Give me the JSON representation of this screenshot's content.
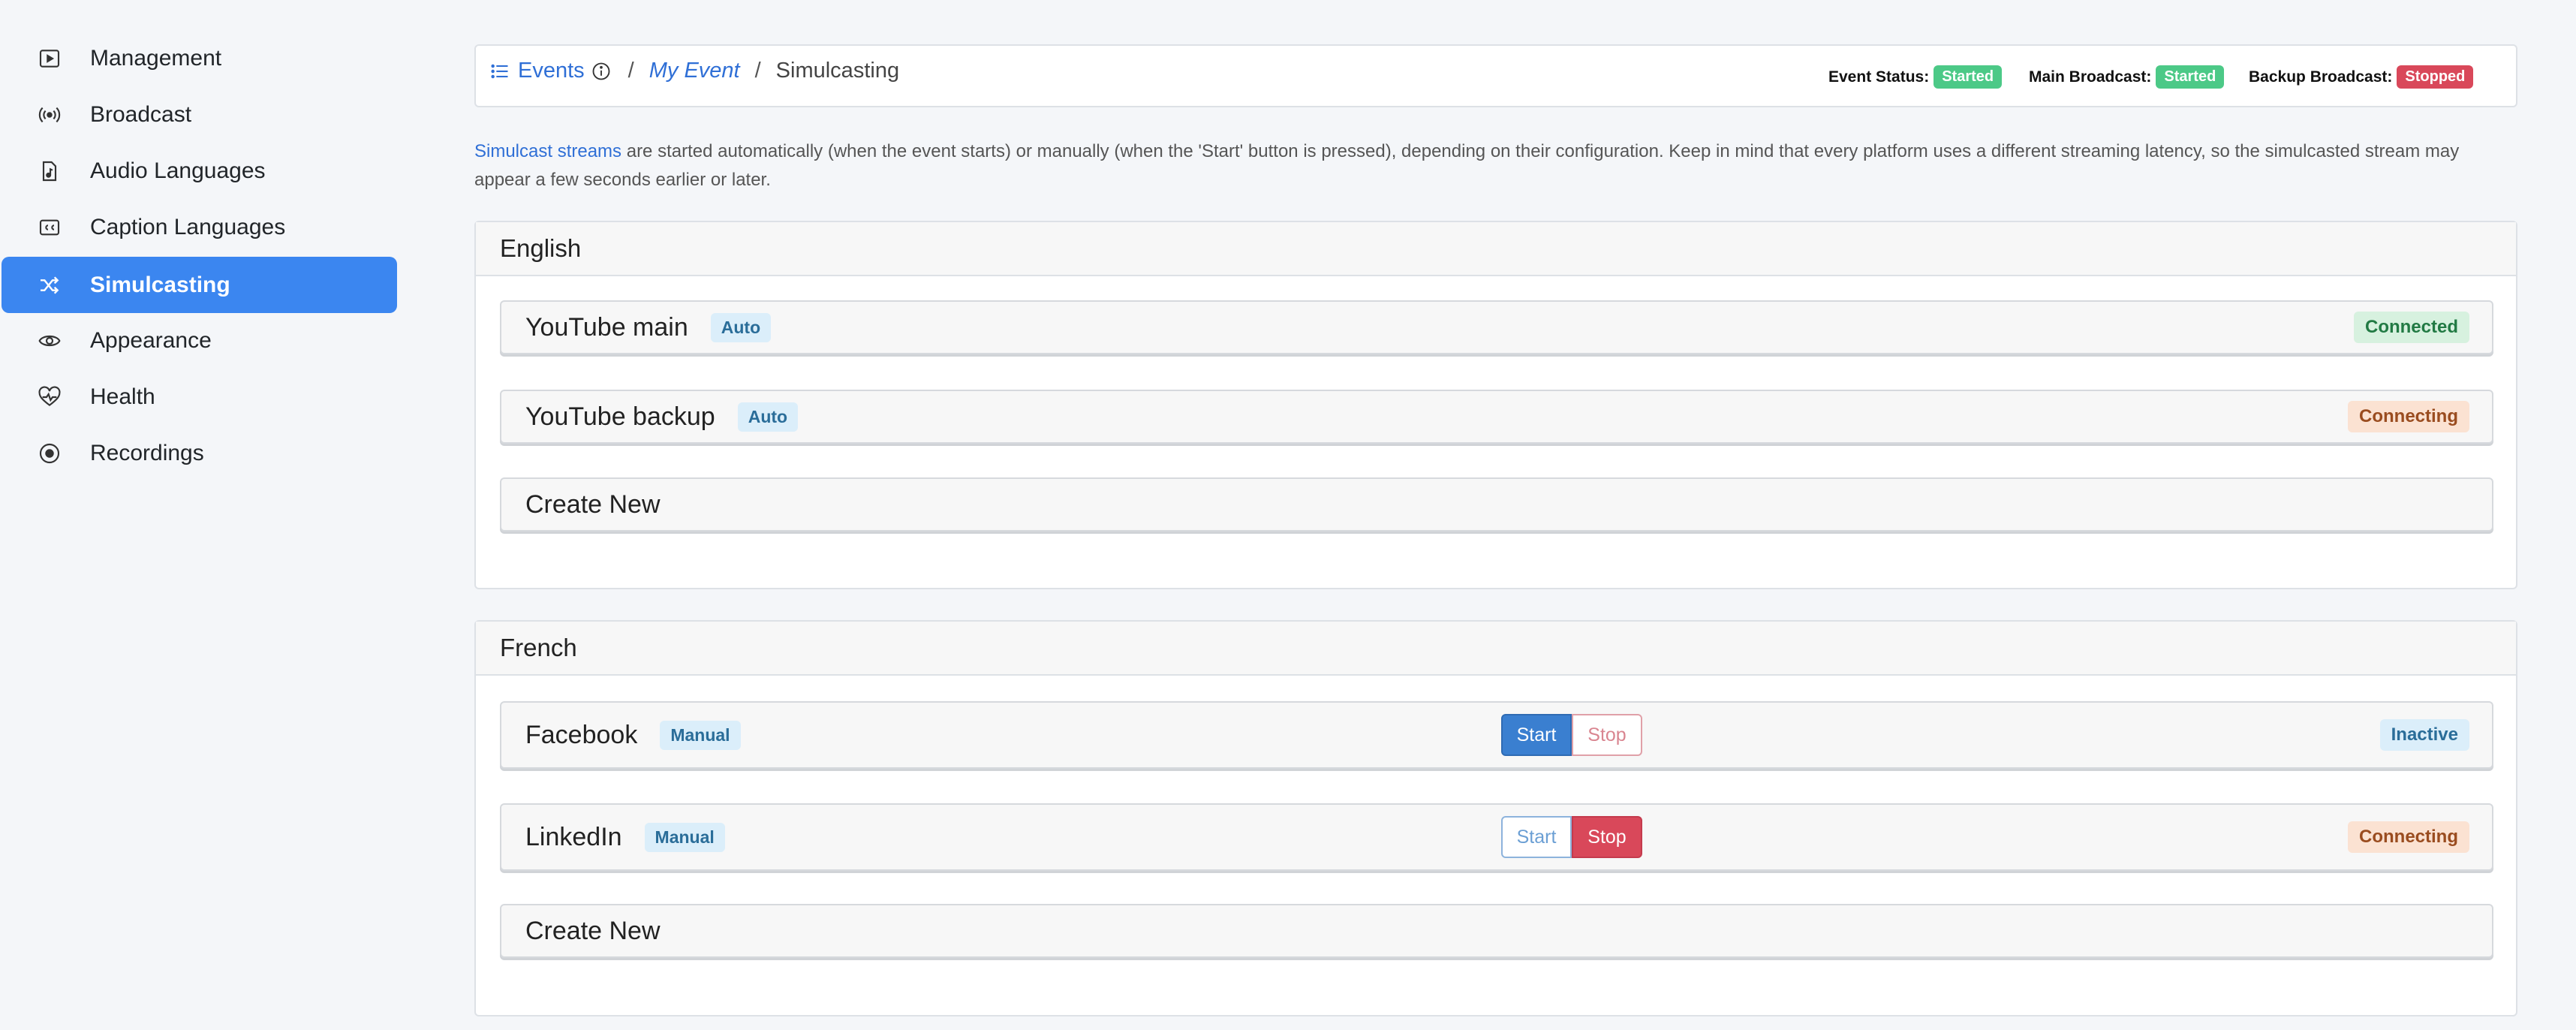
{
  "sidebar": {
    "items": [
      {
        "label": "Management",
        "icon": "play-square-icon",
        "active": false
      },
      {
        "label": "Broadcast",
        "icon": "broadcast-icon",
        "active": false
      },
      {
        "label": "Audio Languages",
        "icon": "audio-file-icon",
        "active": false
      },
      {
        "label": "Caption Languages",
        "icon": "closed-caption-icon",
        "active": false
      },
      {
        "label": "Simulcasting",
        "icon": "shuffle-icon",
        "active": true
      },
      {
        "label": "Appearance",
        "icon": "eye-icon",
        "active": false
      },
      {
        "label": "Health",
        "icon": "heart-pulse-icon",
        "active": false
      },
      {
        "label": "Recordings",
        "icon": "record-circle-icon",
        "active": false
      }
    ]
  },
  "breadcrumb": {
    "events": "Events",
    "event": "My Event",
    "sep": "/",
    "current": "Simulcasting"
  },
  "status": {
    "event_label": "Event Status:",
    "event_value": "Started",
    "main_label": "Main Broadcast:",
    "main_value": "Started",
    "backup_label": "Backup Broadcast:",
    "backup_value": "Stopped"
  },
  "intro": {
    "link": "Simulcast streams",
    "text": " are started automatically (when the event starts) or manually (when the 'Start' button is pressed), depending on their configuration. Keep in mind that every platform uses a different streaming latency, so the simulcasted stream may appear a few seconds earlier or later."
  },
  "languages": [
    {
      "name": "English",
      "streams": [
        {
          "name": "YouTube main",
          "mode": "Auto",
          "status": "Connected"
        },
        {
          "name": "YouTube backup",
          "mode": "Auto",
          "status": "Connecting"
        }
      ],
      "create": "Create New"
    },
    {
      "name": "French",
      "streams": [
        {
          "name": "Facebook",
          "mode": "Manual",
          "start": "Start",
          "stop": "Stop",
          "status": "Inactive"
        },
        {
          "name": "LinkedIn",
          "mode": "Manual",
          "start": "Start",
          "stop": "Stop",
          "status": "Connecting"
        }
      ],
      "create": "Create New"
    }
  ],
  "colors": {
    "accent": "#3b86f0",
    "started": "#4cc987",
    "stopped": "#d9485a"
  }
}
